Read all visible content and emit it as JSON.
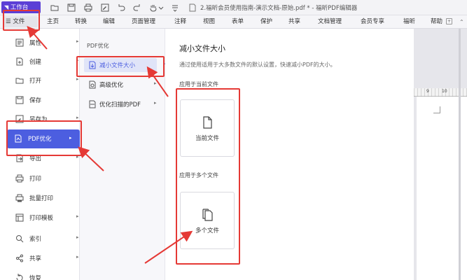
{
  "titlebar": {
    "workbench_label": "工作台",
    "doc_title": "2.福昕会员使用指南-演示文档-原始.pdf * - 福昕PDF编辑器"
  },
  "menubar": {
    "file_label": "文件",
    "items": [
      "主页",
      "转换",
      "编辑",
      "页面管理",
      "注释",
      "视图",
      "表单",
      "保护",
      "共享",
      "文档管理",
      "会员专享",
      "福昕",
      "帮助"
    ]
  },
  "left_menu": {
    "items": [
      {
        "label": "属性",
        "icon": "properties-icon",
        "arrow": true
      },
      {
        "label": "创建",
        "icon": "create-icon",
        "arrow": true
      },
      {
        "label": "打开",
        "icon": "open-icon",
        "arrow": true
      },
      {
        "label": "保存",
        "icon": "save-icon",
        "arrow": false
      },
      {
        "label": "另存为",
        "icon": "save-as-icon",
        "arrow": true
      },
      {
        "label": "PDF优化",
        "icon": "optimize-icon",
        "arrow": true
      },
      {
        "label": "导出",
        "icon": "export-icon",
        "arrow": true
      },
      {
        "label": "打印",
        "icon": "print-icon",
        "arrow": false
      },
      {
        "label": "批量打印",
        "icon": "batch-print-icon",
        "arrow": false
      },
      {
        "label": "打印模板",
        "icon": "print-template-icon",
        "arrow": true
      },
      {
        "label": "索引",
        "icon": "index-icon",
        "arrow": true
      },
      {
        "label": "共享",
        "icon": "share-icon",
        "arrow": true
      },
      {
        "label": "恢复",
        "icon": "restore-icon",
        "arrow": false
      }
    ]
  },
  "pdf_optimize": {
    "heading": "PDF优化",
    "items": [
      {
        "label": "减小文件大小",
        "icon": "reduce-size-icon"
      },
      {
        "label": "高级优化",
        "icon": "advanced-optimize-icon"
      },
      {
        "label": "优化扫描的PDF",
        "icon": "optimize-scanned-icon"
      }
    ]
  },
  "reduce_panel": {
    "title": "减小文件大小",
    "description": "通过使用适用于大多数文件的默认设置，快速减小PDF的大小。",
    "section_current": "应用于当前文件",
    "current_card_label": "当前文件",
    "section_multiple": "应用于多个文件",
    "multiple_card_label": "多个文件"
  },
  "ruler": {
    "numbers": [
      "9",
      "10"
    ]
  },
  "accent_color": "#4c5ee0",
  "annotation_color": "#e53935"
}
